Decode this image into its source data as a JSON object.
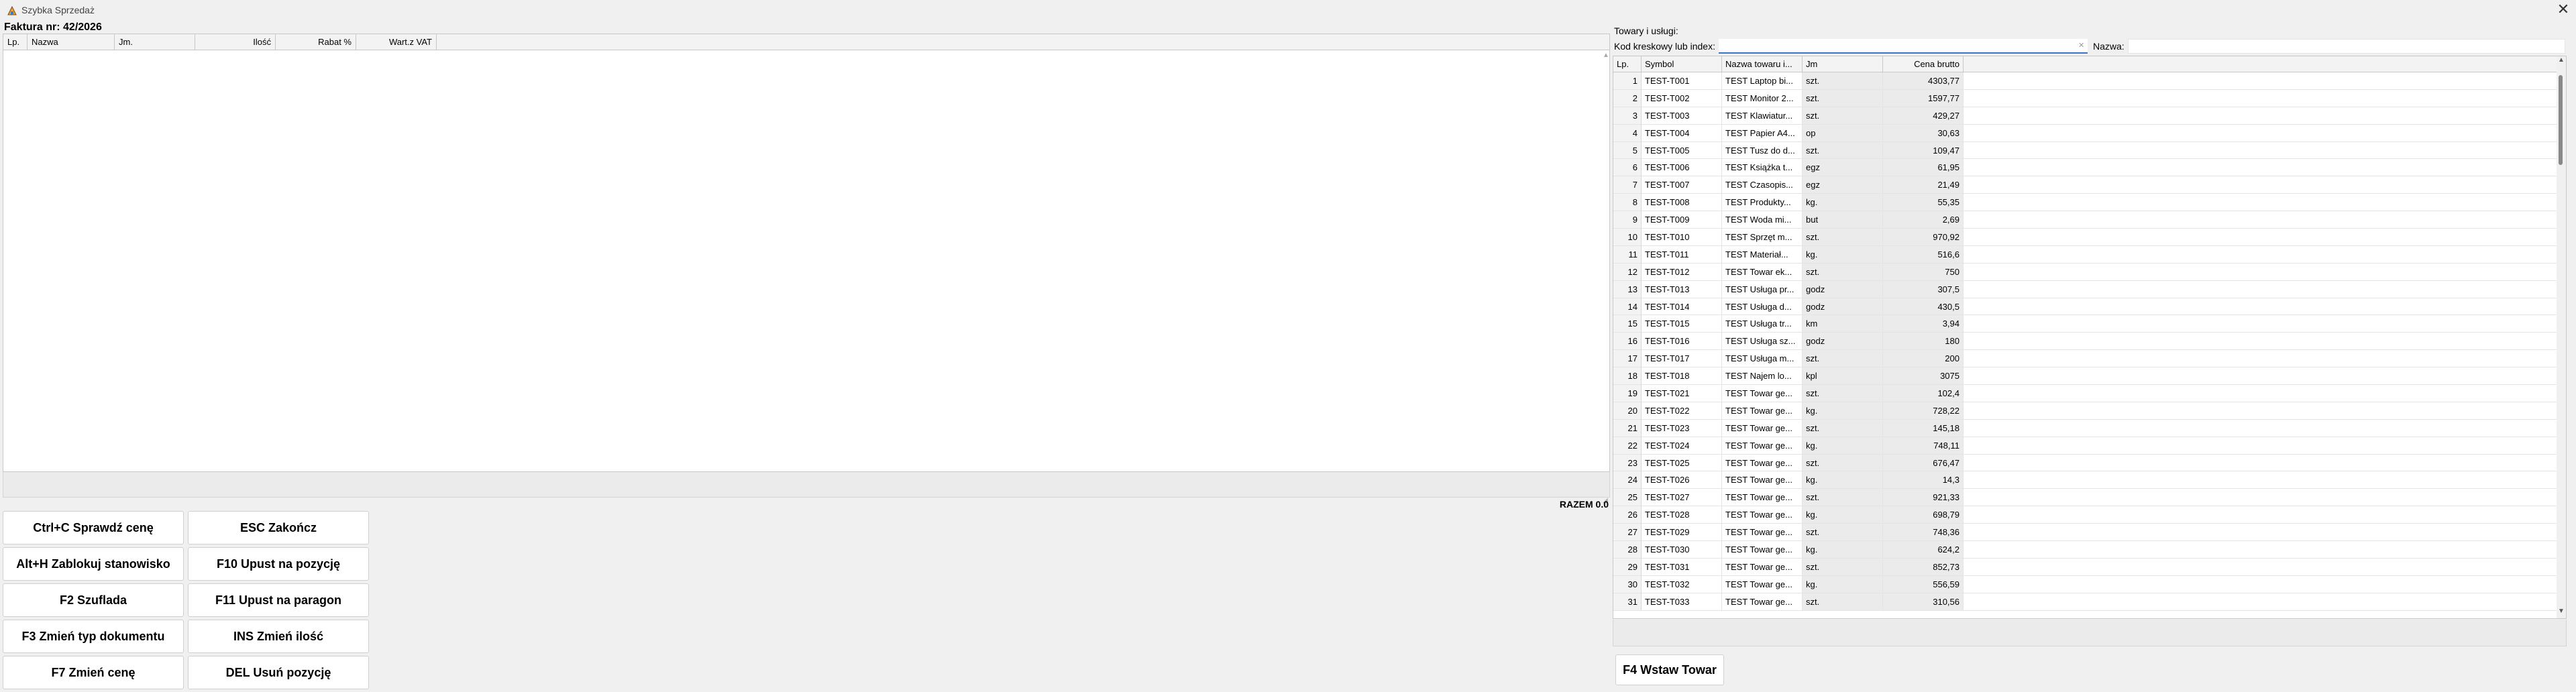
{
  "window": {
    "title": "Szybka Sprzedaż",
    "close_glyph": "✕",
    "icon": "app-icon"
  },
  "invoice": {
    "title": "Faktura nr: 42/2026",
    "columns": [
      "Lp.",
      "Nazwa",
      "Jm.",
      "Ilość",
      "Rabat %",
      "Wart.z VAT"
    ],
    "total_label": "RAZEM 0.0"
  },
  "shortcuts": [
    "Ctrl+C Sprawdź cenę",
    "ESC Zakończ",
    "Alt+H Zablokuj stanowisko",
    "F10 Upust na pozycję",
    "F2 Szuflada",
    "F11 Upust na paragon",
    "F3 Zmień typ dokumentu",
    "INS Zmień ilość",
    "F7 Zmień cenę",
    "DEL Usuń pozycję"
  ],
  "products": {
    "title": "Towary i usługi:",
    "barcode_label": "Kod kreskowy lub index:",
    "barcode_value": "",
    "name_label": "Nazwa:",
    "name_value": "",
    "columns": [
      "Lp.",
      "Symbol",
      "Nazwa towaru i...",
      "Jm",
      "Cena brutto"
    ],
    "rows": [
      [
        "1",
        "TEST-T001",
        "TEST Laptop bi...",
        "szt.",
        "4303,77"
      ],
      [
        "2",
        "TEST-T002",
        "TEST Monitor 2...",
        "szt.",
        "1597,77"
      ],
      [
        "3",
        "TEST-T003",
        "TEST Klawiatur...",
        "szt.",
        "429,27"
      ],
      [
        "4",
        "TEST-T004",
        "TEST Papier A4...",
        "op",
        "30,63"
      ],
      [
        "5",
        "TEST-T005",
        "TEST Tusz do d...",
        "szt.",
        "109,47"
      ],
      [
        "6",
        "TEST-T006",
        "TEST Książka t...",
        "egz",
        "61,95"
      ],
      [
        "7",
        "TEST-T007",
        "TEST Czasopis...",
        "egz",
        "21,49"
      ],
      [
        "8",
        "TEST-T008",
        "TEST Produkty...",
        "kg.",
        "55,35"
      ],
      [
        "9",
        "TEST-T009",
        "TEST Woda mi...",
        "but",
        "2,69"
      ],
      [
        "10",
        "TEST-T010",
        "TEST Sprzęt m...",
        "szt.",
        "970,92"
      ],
      [
        "11",
        "TEST-T011",
        "TEST Materiał...",
        "kg.",
        "516,6"
      ],
      [
        "12",
        "TEST-T012",
        "TEST Towar ek...",
        "szt.",
        "750"
      ],
      [
        "13",
        "TEST-T013",
        "TEST Usługa pr...",
        "godz",
        "307,5"
      ],
      [
        "14",
        "TEST-T014",
        "TEST Usługa d...",
        "godz",
        "430,5"
      ],
      [
        "15",
        "TEST-T015",
        "TEST Usługa tr...",
        "km",
        "3,94"
      ],
      [
        "16",
        "TEST-T016",
        "TEST Usługa sz...",
        "godz",
        "180"
      ],
      [
        "17",
        "TEST-T017",
        "TEST Usługa m...",
        "szt.",
        "200"
      ],
      [
        "18",
        "TEST-T018",
        "TEST Najem lo...",
        "kpl",
        "3075"
      ],
      [
        "19",
        "TEST-T021",
        "TEST Towar ge...",
        "szt.",
        "102,4"
      ],
      [
        "20",
        "TEST-T022",
        "TEST Towar ge...",
        "kg.",
        "728,22"
      ],
      [
        "21",
        "TEST-T023",
        "TEST Towar ge...",
        "szt.",
        "145,18"
      ],
      [
        "22",
        "TEST-T024",
        "TEST Towar ge...",
        "kg.",
        "748,11"
      ],
      [
        "23",
        "TEST-T025",
        "TEST Towar ge...",
        "szt.",
        "676,47"
      ],
      [
        "24",
        "TEST-T026",
        "TEST Towar ge...",
        "kg.",
        "14,3"
      ],
      [
        "25",
        "TEST-T027",
        "TEST Towar ge...",
        "szt.",
        "921,33"
      ],
      [
        "26",
        "TEST-T028",
        "TEST Towar ge...",
        "kg.",
        "698,79"
      ],
      [
        "27",
        "TEST-T029",
        "TEST Towar ge...",
        "szt.",
        "748,36"
      ],
      [
        "28",
        "TEST-T030",
        "TEST Towar ge...",
        "kg.",
        "624,2"
      ],
      [
        "29",
        "TEST-T031",
        "TEST Towar ge...",
        "szt.",
        "852,73"
      ],
      [
        "30",
        "TEST-T032",
        "TEST Towar ge...",
        "kg.",
        "556,59"
      ],
      [
        "31",
        "TEST-T033",
        "TEST Towar ge...",
        "szt.",
        "310,56"
      ]
    ],
    "insert_button": "F4 Wstaw Towar"
  }
}
